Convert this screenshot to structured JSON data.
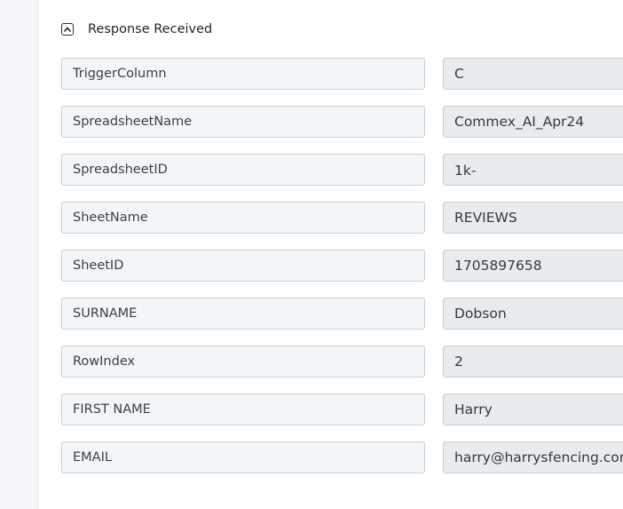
{
  "section": {
    "title": "Response Received",
    "toggle_state": "expanded"
  },
  "fields": [
    {
      "key": "TriggerColumn",
      "value": "C"
    },
    {
      "key": "SpreadsheetName",
      "value": "Commex_AI_Apr24"
    },
    {
      "key": "SpreadsheetID",
      "value": "1k-"
    },
    {
      "key": "SheetName",
      "value": "REVIEWS"
    },
    {
      "key": "SheetID",
      "value": "1705897658"
    },
    {
      "key": "SURNAME",
      "value": "Dobson"
    },
    {
      "key": "RowIndex",
      "value": "2"
    },
    {
      "key": "FIRST NAME",
      "value": "Harry"
    },
    {
      "key": "EMAIL",
      "value": "harry@harrysfencing.com.au"
    }
  ]
}
